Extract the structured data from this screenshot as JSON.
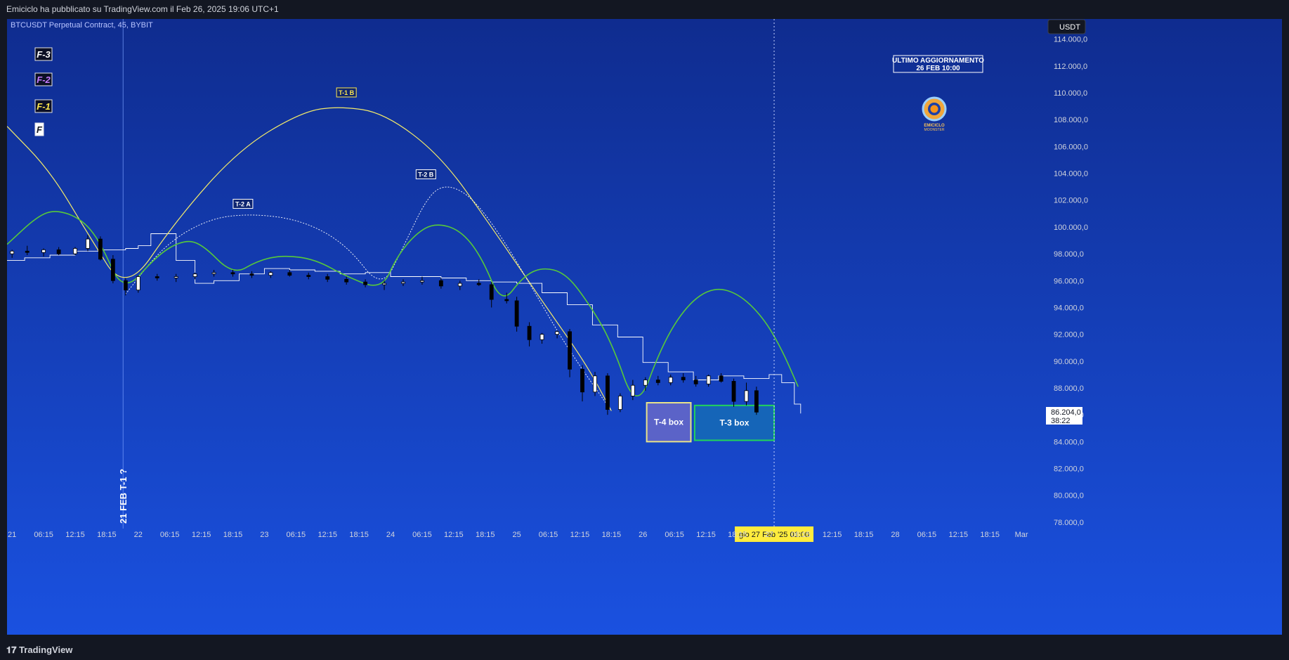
{
  "header": {
    "published": "Emiciclo ha pubblicato su TradingView.com il Feb 26, 2025 19:06 UTC+1"
  },
  "footer": {
    "brand": "TradingView",
    "brand_icon": "tradingview-logo-icon"
  },
  "chart_data": {
    "type": "candlestick",
    "symbol": "BTCUSDT Perpetual Contract, 45, BYBIT",
    "currency": "USDT",
    "last_price": "86.204,0",
    "countdown": "38:22",
    "ylim": [
      77000,
      115500
    ],
    "y_ticks": [
      "114.000,0",
      "112.000,0",
      "110.000,0",
      "108.000,0",
      "106.000,0",
      "104.000,0",
      "102.000,0",
      "100.000,0",
      "98.000,0",
      "96.000,0",
      "94.000,0",
      "92.000,0",
      "90.000,0",
      "88.000,0",
      "86.000,0",
      "84.000,0",
      "82.000,0",
      "80.000,0",
      "78.000,0"
    ],
    "y_tick_values": [
      114000,
      112000,
      110000,
      108000,
      106000,
      104000,
      102000,
      100000,
      98000,
      96000,
      94000,
      92000,
      90000,
      88000,
      86000,
      84000,
      82000,
      80000,
      78000
    ],
    "x_ticks": [
      "21",
      "06:15",
      "12:15",
      "18:15",
      "22",
      "06:15",
      "12:15",
      "18:15",
      "23",
      "06:15",
      "12:15",
      "18:15",
      "24",
      "06:15",
      "12:15",
      "18:15",
      "25",
      "06:15",
      "12:15",
      "18:15",
      "26",
      "06:15",
      "12:15",
      "18:15",
      "27",
      "06:15",
      "12:15",
      "18:15",
      "28",
      "06:15",
      "12:15",
      "18:15",
      "Mar"
    ],
    "x_tick_days": [
      1.0,
      1.25,
      1.5,
      1.75,
      2.0,
      2.25,
      2.5,
      2.75,
      3.0,
      3.25,
      3.5,
      3.75,
      4.0,
      4.25,
      4.5,
      4.75,
      5.0,
      5.25,
      5.5,
      5.75,
      6.0,
      6.25,
      6.5,
      6.75,
      7.0,
      7.25,
      7.5,
      7.75,
      8.0,
      8.25,
      8.5,
      8.75,
      9.0
    ],
    "x_range_days": [
      0.96,
      9.2
    ],
    "crosshair_label": "gio 27 Feb '25   01:00",
    "crosshair_day": 7.04,
    "vertical_marker": {
      "label": "21 FEB T-1 ?",
      "day": 1.88
    },
    "legend_items": [
      {
        "label": "F-3",
        "color": "#ffffff"
      },
      {
        "label": "F-2",
        "color": "#c77bff"
      },
      {
        "label": "F-1",
        "color": "#ffe94d"
      },
      {
        "label": "F",
        "color": "#131722"
      }
    ],
    "annotations": [
      {
        "text": "T-1 B",
        "x_day": 3.65,
        "y": 110000,
        "color": "#ffe94d"
      },
      {
        "text": "T-2 B",
        "x_day": 4.28,
        "y": 103900,
        "color": "#ffffff"
      },
      {
        "text": "T-2 A",
        "x_day": 2.83,
        "y": 101700,
        "color": "#ffffff"
      }
    ],
    "update_note": {
      "line1": "ULTIMO AGGIORNAMENTO",
      "line2": "26 FEB 10:00"
    },
    "watermark": {
      "line1": "EMICICLO",
      "line2": "MOONSTER"
    },
    "boxes": [
      {
        "label": "T-4 box",
        "x0": 6.03,
        "x1": 6.38,
        "y0": 84000,
        "y1": 86900,
        "fill": "#5b63c8",
        "border": "#e8e38a"
      },
      {
        "label": "T-3 box",
        "x0": 6.41,
        "x1": 7.04,
        "y0": 84100,
        "y1": 86700,
        "fill": "#1565b8",
        "border": "#22d45a"
      }
    ],
    "candles": [
      [
        1.0,
        98000,
        98300,
        97700,
        98200
      ],
      [
        1.12,
        98200,
        98600,
        97900,
        98100
      ],
      [
        1.25,
        98100,
        98400,
        97800,
        98300
      ],
      [
        1.37,
        98300,
        98500,
        97900,
        98000
      ],
      [
        1.5,
        98000,
        98500,
        97900,
        98400
      ],
      [
        1.6,
        98400,
        99400,
        98200,
        99100
      ],
      [
        1.7,
        99100,
        99300,
        97500,
        97600
      ],
      [
        1.8,
        97600,
        97900,
        95800,
        96000
      ],
      [
        1.9,
        96000,
        96200,
        94900,
        95300
      ],
      [
        2.0,
        95300,
        96400,
        95100,
        96300
      ],
      [
        2.15,
        96300,
        96500,
        96000,
        96200
      ],
      [
        2.3,
        96200,
        96500,
        95900,
        96300
      ],
      [
        2.45,
        96300,
        96600,
        96100,
        96500
      ],
      [
        2.6,
        96500,
        96800,
        96300,
        96600
      ],
      [
        2.75,
        96600,
        96800,
        96300,
        96500
      ],
      [
        2.9,
        96500,
        96700,
        96200,
        96400
      ],
      [
        3.05,
        96400,
        96700,
        96200,
        96600
      ],
      [
        3.2,
        96600,
        96800,
        96300,
        96400
      ],
      [
        3.35,
        96400,
        96600,
        96100,
        96300
      ],
      [
        3.5,
        96300,
        96500,
        95900,
        96100
      ],
      [
        3.65,
        96100,
        96300,
        95700,
        95900
      ],
      [
        3.8,
        95900,
        96100,
        95500,
        95700
      ],
      [
        3.95,
        95700,
        96000,
        95300,
        95800
      ],
      [
        4.1,
        95800,
        96100,
        95600,
        95900
      ],
      [
        4.25,
        95900,
        96300,
        95700,
        96000
      ],
      [
        4.4,
        96000,
        96200,
        95400,
        95600
      ],
      [
        4.55,
        95600,
        96000,
        95300,
        95800
      ],
      [
        4.7,
        95800,
        96100,
        95600,
        95700
      ],
      [
        4.8,
        95700,
        95900,
        94000,
        94600
      ],
      [
        4.92,
        94600,
        95100,
        94300,
        94500
      ],
      [
        5.0,
        94500,
        94800,
        92200,
        92600
      ],
      [
        5.1,
        92600,
        92900,
        91100,
        91600
      ],
      [
        5.2,
        91600,
        92100,
        91300,
        92000
      ],
      [
        5.32,
        92000,
        92300,
        91700,
        92200
      ],
      [
        5.42,
        92200,
        92400,
        88800,
        89400
      ],
      [
        5.52,
        89400,
        89700,
        87000,
        87700
      ],
      [
        5.62,
        87700,
        89200,
        87400,
        88900
      ],
      [
        5.72,
        88900,
        89100,
        86000,
        86400
      ],
      [
        5.82,
        86400,
        87600,
        86200,
        87400
      ],
      [
        5.92,
        87400,
        88600,
        87100,
        88200
      ],
      [
        6.02,
        88200,
        88800,
        87800,
        88600
      ],
      [
        6.12,
        88600,
        88900,
        88200,
        88400
      ],
      [
        6.22,
        88400,
        89000,
        88200,
        88800
      ],
      [
        6.32,
        88800,
        89100,
        88400,
        88600
      ],
      [
        6.42,
        88600,
        88900,
        88100,
        88300
      ],
      [
        6.52,
        88300,
        89000,
        88100,
        88900
      ],
      [
        6.62,
        88900,
        89100,
        88400,
        88500
      ],
      [
        6.72,
        88500,
        88700,
        86600,
        87000
      ],
      [
        6.82,
        87000,
        88400,
        86700,
        87800
      ],
      [
        6.9,
        87800,
        88100,
        86000,
        86200
      ]
    ],
    "series": [
      {
        "type": "line",
        "color": "#ffffff",
        "x": [
          0.96,
          1.1,
          1.3,
          1.5,
          1.7,
          1.9,
          2.0,
          2.1,
          2.3,
          2.45,
          2.6,
          2.8,
          3.0,
          3.2,
          3.4,
          3.6,
          3.8,
          4.0,
          4.2,
          4.4,
          4.6,
          4.8,
          5.0,
          5.2,
          5.4,
          5.6,
          5.8,
          6.0,
          6.2,
          6.4,
          6.6,
          6.8,
          7.0,
          7.1,
          7.2,
          7.25
        ],
        "y": [
          97500,
          97700,
          97900,
          98200,
          98300,
          98400,
          98600,
          99500,
          97500,
          95800,
          96000,
          96500,
          96900,
          96800,
          96700,
          96500,
          96600,
          96300,
          96300,
          96200,
          96000,
          95900,
          95800,
          95100,
          94200,
          92700,
          91800,
          89900,
          89200,
          88600,
          88900,
          88700,
          89000,
          88400,
          86800,
          86100
        ]
      },
      {
        "type": "arc",
        "color": "#f3ea6a",
        "width": 1.2,
        "points": [
          [
            0.96,
            107500
          ],
          [
            1.3,
            104200
          ],
          [
            1.6,
            99500
          ],
          [
            1.9,
            95000
          ],
          [
            2.3,
            100500
          ],
          [
            2.8,
            105800
          ],
          [
            3.3,
            108600
          ],
          [
            3.6,
            109000
          ],
          [
            3.95,
            108500
          ],
          [
            4.4,
            105300
          ],
          [
            4.8,
            100000
          ],
          [
            5.2,
            94500
          ],
          [
            5.55,
            89800
          ],
          [
            5.75,
            86300
          ]
        ]
      },
      {
        "type": "arc",
        "color": "#ffffff",
        "width": 0.9,
        "dash": "2 2",
        "points": [
          [
            1.9,
            95000
          ],
          [
            2.2,
            98600
          ],
          [
            2.55,
            100600
          ],
          [
            2.9,
            101000
          ],
          [
            3.3,
            100500
          ],
          [
            3.65,
            98700
          ],
          [
            3.93,
            95300
          ],
          [
            4.1,
            98500
          ],
          [
            4.3,
            102400
          ],
          [
            4.45,
            103200
          ],
          [
            4.65,
            102200
          ],
          [
            4.9,
            99000
          ],
          [
            5.15,
            95000
          ],
          [
            5.4,
            91000
          ],
          [
            5.75,
            86300
          ]
        ]
      },
      {
        "type": "arc",
        "color": "#57c93a",
        "width": 1.6,
        "points": [
          [
            0.96,
            98700
          ],
          [
            1.2,
            100800
          ],
          [
            1.35,
            101300
          ],
          [
            1.55,
            100600
          ],
          [
            1.7,
            98900
          ],
          [
            1.88,
            95000
          ],
          [
            2.15,
            97900
          ],
          [
            2.35,
            99000
          ],
          [
            2.5,
            98800
          ],
          [
            2.75,
            96400
          ],
          [
            2.95,
            97500
          ],
          [
            3.15,
            97900
          ],
          [
            3.4,
            97600
          ],
          [
            3.65,
            96300
          ],
          [
            3.93,
            95300
          ],
          [
            4.05,
            97800
          ],
          [
            4.2,
            99500
          ],
          [
            4.35,
            100300
          ],
          [
            4.55,
            99800
          ],
          [
            4.72,
            97800
          ],
          [
            4.88,
            94200
          ],
          [
            5.05,
            96300
          ],
          [
            5.2,
            97000
          ],
          [
            5.38,
            96600
          ],
          [
            5.55,
            94600
          ],
          [
            5.75,
            91500
          ],
          [
            5.95,
            86100
          ],
          [
            6.15,
            91200
          ],
          [
            6.35,
            94200
          ],
          [
            6.55,
            95500
          ],
          [
            6.75,
            95100
          ],
          [
            6.95,
            93300
          ],
          [
            7.1,
            90900
          ],
          [
            7.23,
            88100
          ]
        ]
      }
    ]
  }
}
